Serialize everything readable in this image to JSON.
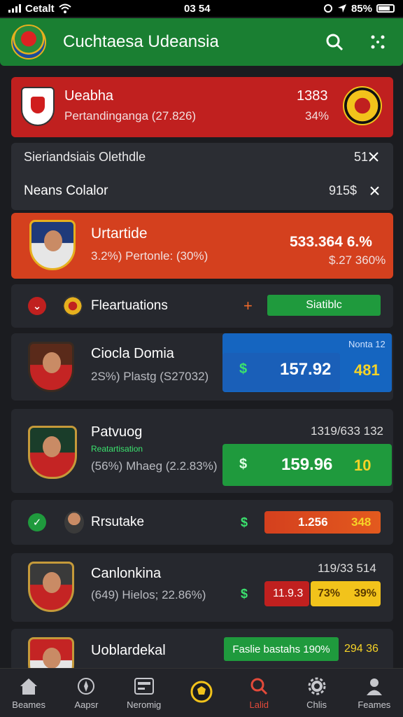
{
  "status": {
    "carrier": "Cetalt",
    "time": "03 54",
    "battery": "85%"
  },
  "header": {
    "title": "Cuchtaesa Udeansia"
  },
  "match": {
    "team": "Ueabha",
    "subtitle": "Pertandinganga (27.826)",
    "score": "1383",
    "percent": "34%"
  },
  "filters": {
    "row1_label": "Sieriandsiais Olethdle",
    "row1_value": "51",
    "row2_label": "Neans Colalor",
    "row2_value": "915$"
  },
  "hero": {
    "name": "Urtartide",
    "stats": "3.2%)   Pertonle: (30%)",
    "price": "533.364  6.%",
    "sub": "$.27  360%"
  },
  "flashbar": {
    "label": "Fleartuations",
    "plus": "+",
    "button": "Siatiblc"
  },
  "players": [
    {
      "name": "Ciocla Domia",
      "stats": "2S%)   Plastg (S27032)",
      "box_label": "Nonta 12",
      "dollar": "$",
      "price": "157.92",
      "extra": "481"
    },
    {
      "name": "Patvuog",
      "tag": "Reatartisation",
      "stats": "(56%)   Mhaeg (2.2.83%)",
      "top": "1319/633 132",
      "dollar": "$",
      "price": "159.96",
      "extra": "10"
    },
    {
      "name": "Rrsutake",
      "dollar": "$",
      "price": "1.256",
      "extra": "348"
    },
    {
      "name": "Canlonkina",
      "stats": "(649)   Hielos; 22.86%)",
      "top": "119/33 514",
      "dollar": "$",
      "red_val": "11.9.3",
      "yellow_val": "73%",
      "yellow_val2": "39%"
    },
    {
      "name": "Uoblardekal",
      "pill": "Faslie bastahs  190%",
      "extra": "294  36"
    }
  ],
  "tabs": [
    {
      "label": "Beames",
      "icon": "home-icon"
    },
    {
      "label": "Aapsr",
      "icon": "compass-icon"
    },
    {
      "label": "Neromig",
      "icon": "card-icon"
    },
    {
      "label": "",
      "icon": "ball-icon"
    },
    {
      "label": "Lalid",
      "icon": "search-icon"
    },
    {
      "label": "Chlis",
      "icon": "gear-icon"
    },
    {
      "label": "Feames",
      "icon": "profile-icon"
    }
  ],
  "colors": {
    "green": "#1a7f32",
    "red": "#c0201f",
    "orange": "#d4401e",
    "blue": "#1565c0",
    "yellow": "#f2c31b"
  }
}
